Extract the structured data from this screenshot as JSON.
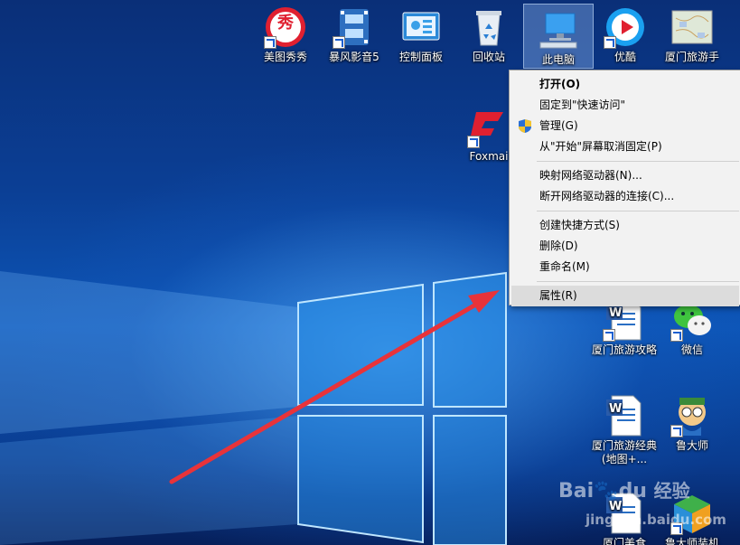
{
  "desktop_icons": {
    "meitu": {
      "label": "美图秀秀",
      "badge": "秀",
      "icon": "meitu-icon"
    },
    "baofeng": {
      "label": "暴风影音5",
      "icon": "film-icon"
    },
    "control_panel": {
      "label": "控制面板",
      "icon": "control-panel-icon"
    },
    "recycle_bin": {
      "label": "回收站",
      "icon": "recycle-bin-icon"
    },
    "this_pc": {
      "label": "此电脑",
      "icon": "computer-icon"
    },
    "youku": {
      "label": "优酷",
      "icon": "youku-play-icon"
    },
    "xiamen_travel": {
      "label": "厦门旅游手",
      "icon": "map-icon"
    },
    "foxmail": {
      "label": "Foxmai",
      "icon": "foxmail-icon"
    },
    "xiamen_guide": {
      "label": "厦门旅游攻略",
      "icon": "word-document-icon"
    },
    "wechat": {
      "label": "微信",
      "icon": "wechat-icon"
    },
    "xiamen_classic": {
      "label": "厦门旅游经典(地图+...",
      "icon": "word-document-icon"
    },
    "ludashi": {
      "label": "鲁大师",
      "icon": "ludashi-icon"
    },
    "xiamen_food": {
      "label": "厦门美食",
      "icon": "word-document-icon"
    },
    "ludashi_install": {
      "label": "鲁大师装机",
      "icon": "install-box-icon"
    }
  },
  "context_menu": {
    "open": "打开(O)",
    "pin_quick_access": "固定到\"快速访问\"",
    "manage": "管理(G)",
    "unpin_start": "从\"开始\"屏幕取消固定(P)",
    "map_drive": "映射网络驱动器(N)...",
    "disconnect_drive": "断开网络驱动器的连接(C)...",
    "create_shortcut": "创建快捷方式(S)",
    "delete": "删除(D)",
    "rename": "重命名(M)",
    "properties": "属性(R)"
  },
  "watermark": {
    "brand": "Bai",
    "brand2": "du",
    "site_cn": "经验",
    "site_url": "jingyan.baidu.com"
  },
  "colors": {
    "arrow": "#e8333a",
    "menu_bg": "#f2f2f2",
    "menu_hover": "#dcdcdc",
    "accent": "#1d5fd0"
  }
}
